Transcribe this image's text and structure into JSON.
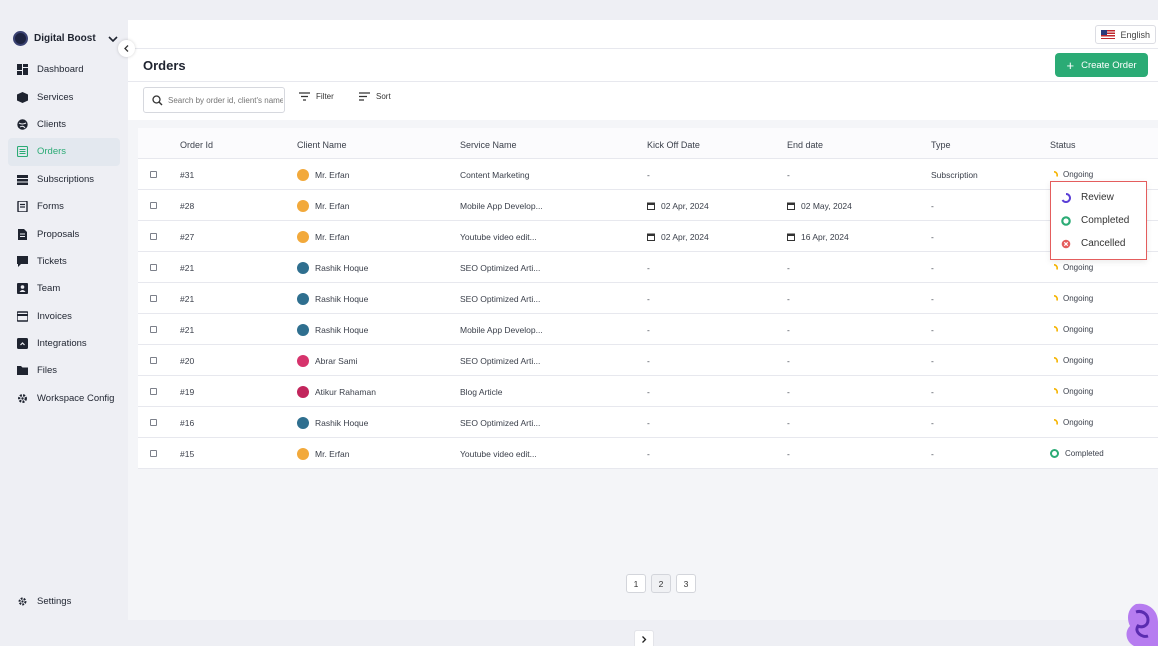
{
  "workspace": {
    "name": "Digital Boost"
  },
  "sidebar": {
    "items": [
      {
        "label": "Dashboard",
        "icon": "dashboard-icon"
      },
      {
        "label": "Services",
        "icon": "box-icon"
      },
      {
        "label": "Clients",
        "icon": "globe-icon"
      },
      {
        "label": "Orders",
        "icon": "orders-icon",
        "active": true
      },
      {
        "label": "Subscriptions",
        "icon": "layers-icon"
      },
      {
        "label": "Forms",
        "icon": "form-icon"
      },
      {
        "label": "Proposals",
        "icon": "document-icon"
      },
      {
        "label": "Tickets",
        "icon": "ticket-icon"
      },
      {
        "label": "Team",
        "icon": "team-icon"
      },
      {
        "label": "Invoices",
        "icon": "card-icon"
      },
      {
        "label": "Integrations",
        "icon": "plug-icon"
      },
      {
        "label": "Files",
        "icon": "folder-icon"
      },
      {
        "label": "Workspace Config",
        "icon": "gear-icon"
      }
    ],
    "settings_label": "Settings"
  },
  "topbar": {
    "language": "English"
  },
  "header": {
    "title": "Orders",
    "create_label": "Create Order"
  },
  "toolbar": {
    "search_placeholder": "Search by order id, client's name",
    "filter_label": "Filter",
    "sort_label": "Sort"
  },
  "table": {
    "columns": [
      "Order Id",
      "Client Name",
      "Service Name",
      "Kick Off Date",
      "End date",
      "Type",
      "Status"
    ],
    "rows": [
      {
        "id": "#31",
        "client": "Mr. Erfan",
        "avatar": "#f2a93b",
        "service": "Content Marketing",
        "kickoff": "-",
        "end": "-",
        "type": "Subscription",
        "status": "Ongoing"
      },
      {
        "id": "#28",
        "client": "Mr. Erfan",
        "avatar": "#f2a93b",
        "service": "Mobile App Develop...",
        "kickoff": "02 Apr, 2024",
        "end": "02 May, 2024",
        "type": "-",
        "status": ""
      },
      {
        "id": "#27",
        "client": "Mr. Erfan",
        "avatar": "#f2a93b",
        "service": "Youtube video edit...",
        "kickoff": "02 Apr, 2024",
        "end": "16 Apr, 2024",
        "type": "-",
        "status": ""
      },
      {
        "id": "#21",
        "client": "Rashik Hoque",
        "avatar": "#2f6f8f",
        "service": "SEO Optimized Arti...",
        "kickoff": "-",
        "end": "-",
        "type": "-",
        "status": "Ongoing"
      },
      {
        "id": "#21",
        "client": "Rashik Hoque",
        "avatar": "#2f6f8f",
        "service": "SEO Optimized Arti...",
        "kickoff": "-",
        "end": "-",
        "type": "-",
        "status": "Ongoing"
      },
      {
        "id": "#21",
        "client": "Rashik Hoque",
        "avatar": "#2f6f8f",
        "service": "Mobile App Develop...",
        "kickoff": "-",
        "end": "-",
        "type": "-",
        "status": "Ongoing"
      },
      {
        "id": "#20",
        "client": "Abrar Sami",
        "avatar": "#d6336c",
        "service": "SEO Optimized Arti...",
        "kickoff": "-",
        "end": "-",
        "type": "-",
        "status": "Ongoing"
      },
      {
        "id": "#19",
        "client": "Atikur Rahaman",
        "avatar": "#c2255c",
        "service": "Blog Article",
        "kickoff": "-",
        "end": "-",
        "type": "-",
        "status": "Ongoing"
      },
      {
        "id": "#16",
        "client": "Rashik Hoque",
        "avatar": "#2f6f8f",
        "service": "SEO Optimized Arti...",
        "kickoff": "-",
        "end": "-",
        "type": "-",
        "status": "Ongoing"
      },
      {
        "id": "#15",
        "client": "Mr. Erfan",
        "avatar": "#f2a93b",
        "service": "Youtube video edit...",
        "kickoff": "-",
        "end": "-",
        "type": "-",
        "status": "Completed"
      }
    ]
  },
  "status_dropdown": {
    "options": [
      {
        "label": "Review",
        "color": "#5b3fd6"
      },
      {
        "label": "Completed",
        "color": "#2bab75"
      },
      {
        "label": "Cancelled",
        "color": "#e45d5d"
      }
    ]
  },
  "pagination": {
    "pages": [
      "1",
      "2",
      "3"
    ]
  },
  "colors": {
    "accent": "#2bab75",
    "ongoing": "#f5b400"
  }
}
